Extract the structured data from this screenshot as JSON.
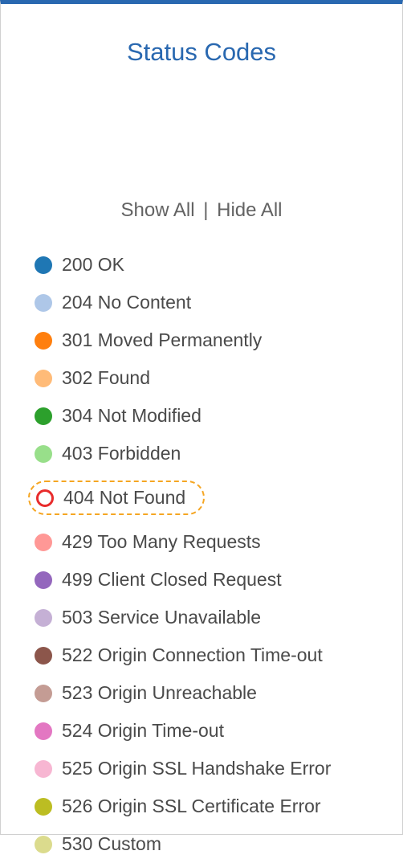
{
  "header": {
    "title": "Status Codes"
  },
  "controls": {
    "show_all": "Show All",
    "hide_all": "Hide All",
    "divider": "|"
  },
  "legend": {
    "items": [
      {
        "label": "200 OK",
        "color": "#1f77b4",
        "highlighted": false,
        "outline": false
      },
      {
        "label": "204 No Content",
        "color": "#aec7e8",
        "highlighted": false,
        "outline": false
      },
      {
        "label": "301 Moved Permanently",
        "color": "#ff7f0e",
        "highlighted": false,
        "outline": false
      },
      {
        "label": "302 Found",
        "color": "#ffbb78",
        "highlighted": false,
        "outline": false
      },
      {
        "label": "304 Not Modified",
        "color": "#2ca02c",
        "highlighted": false,
        "outline": false
      },
      {
        "label": "403 Forbidden",
        "color": "#98df8a",
        "highlighted": false,
        "outline": false
      },
      {
        "label": "404 Not Found",
        "color": "#e82c2c",
        "highlighted": true,
        "outline": true
      },
      {
        "label": "429 Too Many Requests",
        "color": "#ff9896",
        "highlighted": false,
        "outline": false
      },
      {
        "label": "499 Client Closed Request",
        "color": "#9467bd",
        "highlighted": false,
        "outline": false
      },
      {
        "label": "503 Service Unavailable",
        "color": "#c5b0d5",
        "highlighted": false,
        "outline": false
      },
      {
        "label": "522 Origin Connection Time-out",
        "color": "#8c564b",
        "highlighted": false,
        "outline": false
      },
      {
        "label": "523 Origin Unreachable",
        "color": "#c49c94",
        "highlighted": false,
        "outline": false
      },
      {
        "label": "524 Origin Time-out",
        "color": "#e377c2",
        "highlighted": false,
        "outline": false
      },
      {
        "label": "525 Origin SSL Handshake Error",
        "color": "#f7b6d2",
        "highlighted": false,
        "outline": false
      },
      {
        "label": "526 Origin SSL Certificate Error",
        "color": "#bcbd22",
        "highlighted": false,
        "outline": false
      },
      {
        "label": "530 Custom",
        "color": "#dbdb8d",
        "highlighted": false,
        "outline": false
      }
    ]
  }
}
